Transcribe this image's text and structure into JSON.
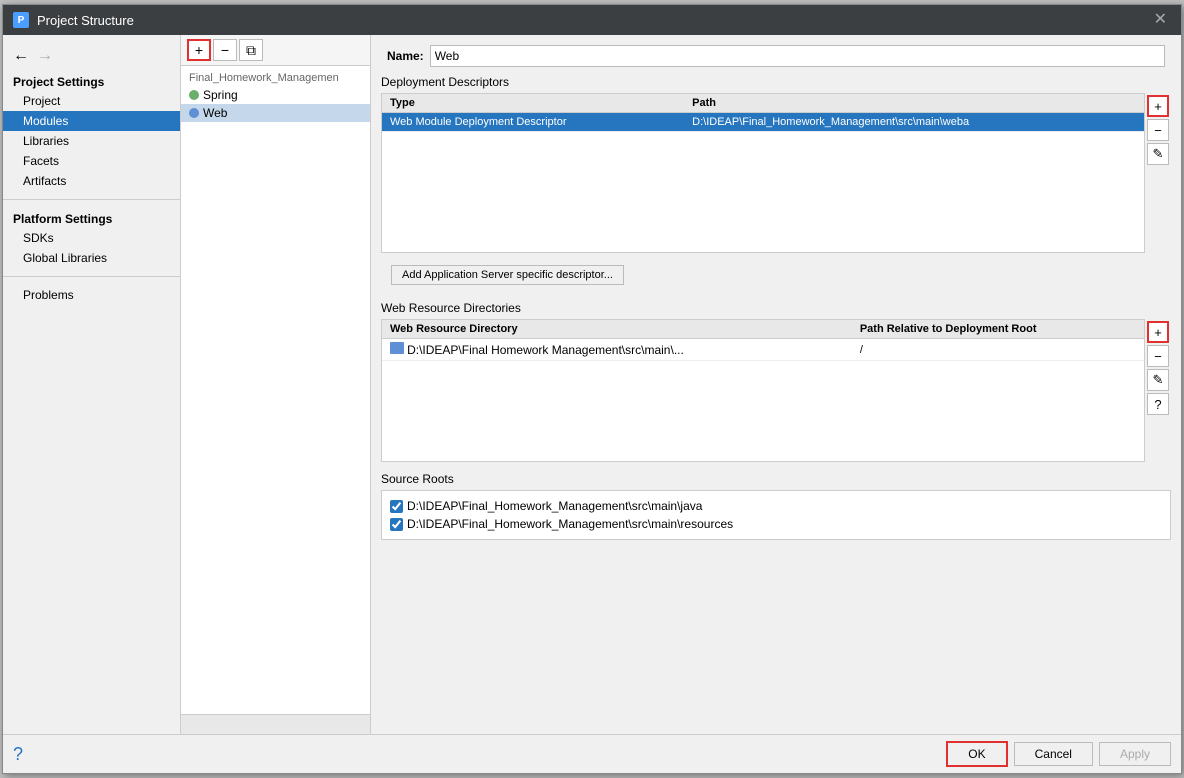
{
  "dialog": {
    "title": "Project Structure",
    "close_label": "✕"
  },
  "nav": {
    "back_label": "←",
    "forward_label": "→"
  },
  "sidebar": {
    "project_settings_label": "Project Settings",
    "items": [
      {
        "id": "project",
        "label": "Project",
        "active": false
      },
      {
        "id": "modules",
        "label": "Modules",
        "active": true
      },
      {
        "id": "libraries",
        "label": "Libraries",
        "active": false
      },
      {
        "id": "facets",
        "label": "Facets",
        "active": false
      },
      {
        "id": "artifacts",
        "label": "Artifacts",
        "active": false
      }
    ],
    "platform_settings_label": "Platform Settings",
    "platform_items": [
      {
        "id": "sdks",
        "label": "SDKs",
        "active": false
      },
      {
        "id": "global-libraries",
        "label": "Global Libraries",
        "active": false
      }
    ],
    "problems_label": "Problems"
  },
  "module_panel": {
    "add_btn": "+",
    "remove_btn": "−",
    "copy_btn": "⧉",
    "group_label": "Final_Homework_Managemen",
    "items": [
      {
        "id": "spring",
        "label": "Spring",
        "type": "spring"
      },
      {
        "id": "web",
        "label": "Web",
        "type": "web",
        "selected": true
      }
    ]
  },
  "main": {
    "name_label": "Name:",
    "name_value": "Web",
    "deployment_descriptors": {
      "title": "Deployment Descriptors",
      "columns": [
        "Type",
        "Path"
      ],
      "rows": [
        {
          "type": "Web Module Deployment Descriptor",
          "path": "D:\\IDEAP\\Final_Homework_Management\\src\\main\\weba",
          "selected": true
        }
      ],
      "add_btn": "+",
      "remove_btn": "−",
      "edit_btn": "✎"
    },
    "add_server_btn_label": "Add Application Server specific descriptor...",
    "web_resource_directories": {
      "title": "Web Resource Directories",
      "columns": [
        "Web Resource Directory",
        "Path Relative to Deployment Root"
      ],
      "rows": [
        {
          "dir": "D:\\IDEAP\\Final Homework Management\\src\\main\\...",
          "path": "/"
        }
      ],
      "add_btn": "+",
      "remove_btn": "−",
      "edit_btn": "✎",
      "help_btn": "?"
    },
    "source_roots": {
      "title": "Source Roots",
      "items": [
        {
          "label": "D:\\IDEAP\\Final_Homework_Management\\src\\main\\java",
          "checked": true
        },
        {
          "label": "D:\\IDEAP\\Final_Homework_Management\\src\\main\\resources",
          "checked": true
        }
      ]
    }
  },
  "footer": {
    "ok_label": "OK",
    "cancel_label": "Cancel",
    "apply_label": "Apply"
  }
}
